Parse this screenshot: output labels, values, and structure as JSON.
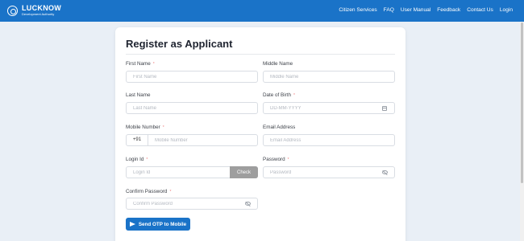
{
  "header": {
    "brand_title": "LUCKNOW",
    "brand_subtitle": "Development Authority",
    "nav": [
      "Citizen Services",
      "FAQ",
      "User Manual",
      "Feedback",
      "Contact Us",
      "Login"
    ]
  },
  "form": {
    "title": "Register as Applicant",
    "required_mark": "*",
    "first_name": {
      "label": "First Name",
      "placeholder": "First Name",
      "value": ""
    },
    "middle_name": {
      "label": "Middle Name",
      "placeholder": "Middle Name",
      "value": ""
    },
    "last_name": {
      "label": "Last Name",
      "placeholder": "Last Name",
      "value": ""
    },
    "dob": {
      "label": "Date of Birth",
      "placeholder": "DD-MM-YYYY",
      "value": ""
    },
    "mobile": {
      "label": "Mobile Number",
      "prefix": "+91",
      "placeholder": "Mobile Number",
      "value": ""
    },
    "email": {
      "label": "Email Address",
      "placeholder": "Email Address",
      "value": ""
    },
    "login_id": {
      "label": "Login Id",
      "placeholder": "Login Id",
      "value": "",
      "check_label": "Check"
    },
    "password": {
      "label": "Password",
      "placeholder": "Password",
      "value": ""
    },
    "confirm_password": {
      "label": "Confirm Password",
      "placeholder": "Confirm Password",
      "value": ""
    },
    "submit_label": "Send OTP to Mobile"
  },
  "colors": {
    "header": "#1a73c8",
    "primary_button": "#1a73c8",
    "check_button": "#9e9e9e",
    "required": "#f07c7c",
    "background": "#e9eff6"
  },
  "icons": [
    "logo-icon",
    "calendar-icon",
    "eye-off-icon",
    "send-icon"
  ]
}
